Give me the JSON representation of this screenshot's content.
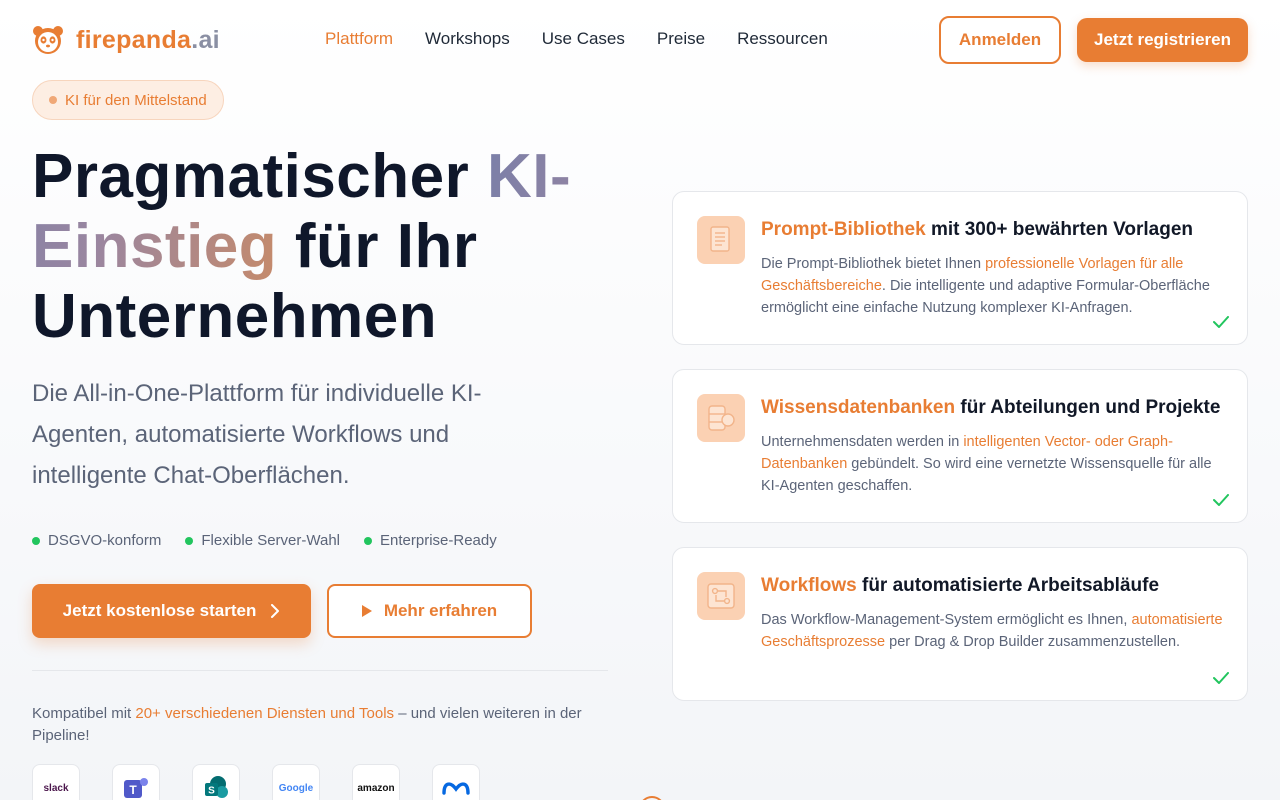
{
  "brand": {
    "name_part1": "firepanda",
    "name_part2": ".ai"
  },
  "nav": {
    "links": [
      {
        "label": "Plattform",
        "active": true
      },
      {
        "label": "Workshops",
        "active": false
      },
      {
        "label": "Use Cases",
        "active": false
      },
      {
        "label": "Preise",
        "active": false
      },
      {
        "label": "Ressourcen",
        "active": false
      }
    ],
    "login_label": "Anmelden",
    "register_label": "Jetzt registrieren"
  },
  "hero": {
    "badge": "KI für den Mittelstand",
    "headline_part1": "Pragmatischer ",
    "headline_highlight": "KI-Einstieg",
    "headline_part2": " für Ihr Unternehmen",
    "subline": "Die All-in-One-Plattform für individuelle KI-Agenten, automatisierte Workflows und intelligente Chat-Oberflächen.",
    "checks": [
      "DSGVO-konform",
      "Flexible Server-Wahl",
      "Enterprise-Ready"
    ],
    "cta_primary": "Jetzt kostenlose starten",
    "cta_secondary": "Mehr erfahren",
    "compat_prefix": "Kompatibel mit ",
    "compat_highlight": "20+ verschiedenen Diensten und Tools",
    "compat_suffix": " – und vielen weiteren in der Pipeline!",
    "tools": [
      "slack",
      "Teams",
      "SharePoint",
      "Google",
      "amazon",
      "Meta"
    ]
  },
  "features": [
    {
      "title_highlight": "Prompt-Bibliothek",
      "title_rest": " mit 300+ bewährten Vorlagen",
      "desc_pre": "Die Prompt-Bibliothek bietet Ihnen ",
      "desc_highlight": "professionelle Vorlagen für alle Geschäftsbereiche",
      "desc_post": ". Die intelligente und adaptive Formular-Oberfläche ermöglicht eine einfache Nutzung komplexer KI-Anfragen.",
      "icon": "document-icon"
    },
    {
      "title_highlight": "Wissensdatenbanken",
      "title_rest": " für Abteilungen und Projekte",
      "desc_pre": "Unternehmensdaten werden in ",
      "desc_highlight": "intelligenten Vector- oder Graph-Datenbanken",
      "desc_post": " gebündelt. So wird eine vernetzte Wissensquelle für alle KI-Agenten geschaffen.",
      "icon": "database-icon"
    },
    {
      "title_highlight": "Workflows",
      "title_rest": " für automatisierte Arbeitsabläufe",
      "desc_pre": "Das Workflow-Management-System ermöglicht es Ihnen, ",
      "desc_highlight": "automatisierte Geschäftsprozesse",
      "desc_post": " per Drag & Drop Builder zusammenzustellen.",
      "icon": "workflow-icon"
    }
  ],
  "colors": {
    "accent": "#e87d33",
    "success": "#22c55e",
    "text": "#0f172a",
    "muted": "#5b6478"
  }
}
